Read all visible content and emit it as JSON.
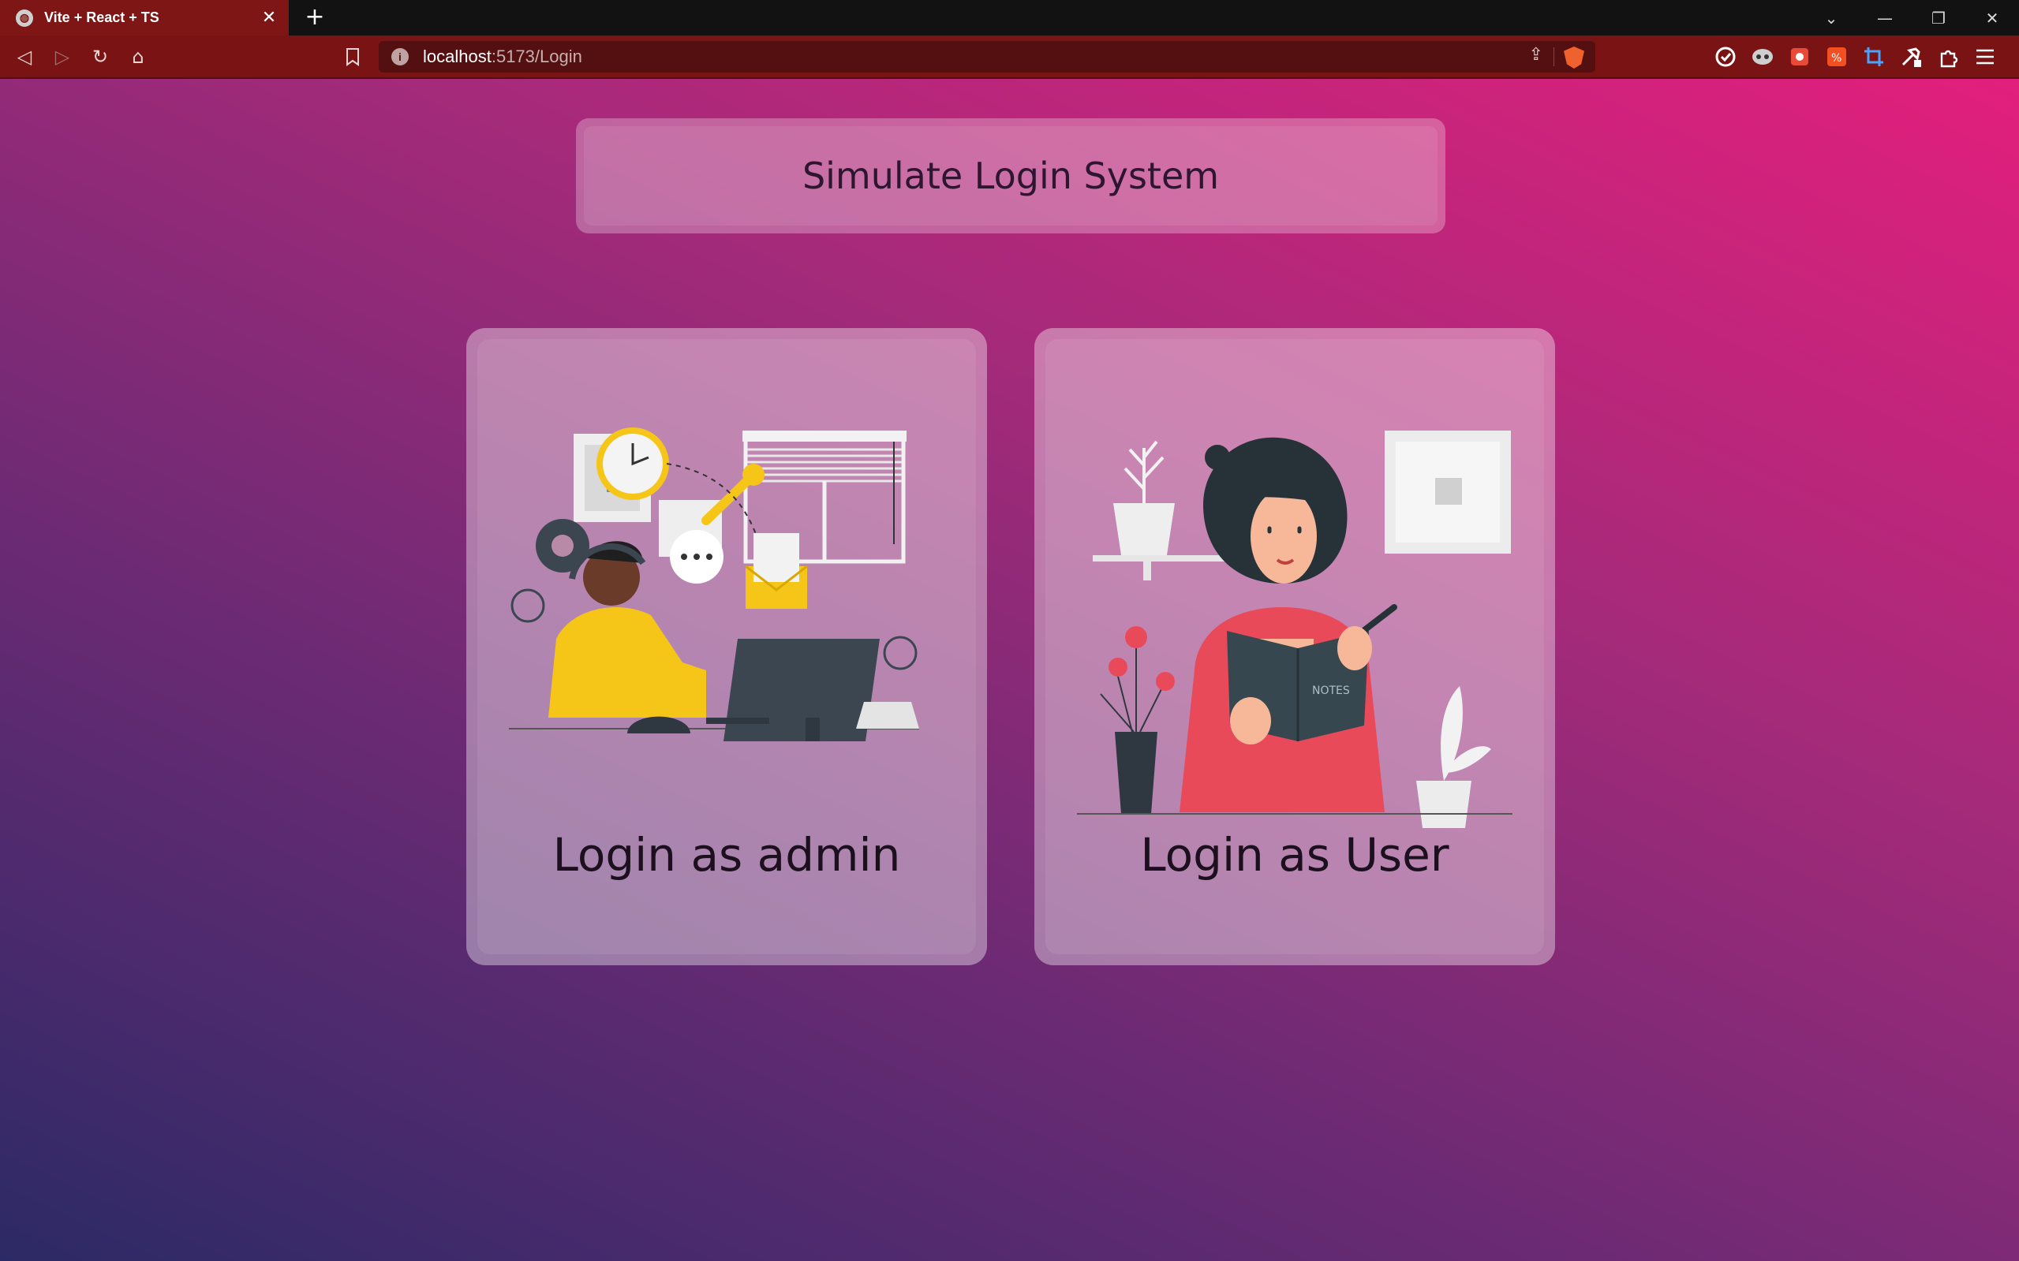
{
  "browser": {
    "tab": {
      "title": "Vite + React + TS",
      "close_glyph": "✕"
    },
    "new_tab_glyph": "+",
    "url": {
      "host": "localhost",
      "rest": ":5173/Login"
    },
    "nav": {
      "back": "◁",
      "forward": "▷",
      "reload": "↻",
      "home": "⌂",
      "bookmark": "🔖"
    },
    "window": {
      "list": "⌄",
      "minimize": "—",
      "restore": "❐",
      "close": "✕"
    },
    "extensions": [
      "shield-icon",
      "mask-icon",
      "puzzle-red-icon",
      "translate-icon",
      "crop-icon",
      "hammer-icon",
      "puzzle-icon",
      "menu-icon"
    ]
  },
  "page": {
    "title": "Simulate Login System",
    "cards": [
      {
        "label": "Login as admin",
        "illustration": "admin-illustration"
      },
      {
        "label": "Login as User",
        "illustration": "user-illustration"
      }
    ]
  },
  "colors": {
    "gradient_top_right": "#e21f7c",
    "gradient_bottom_left": "#2c2a66",
    "tab_active": "#7f1616",
    "toolbar": "#7a1313"
  }
}
